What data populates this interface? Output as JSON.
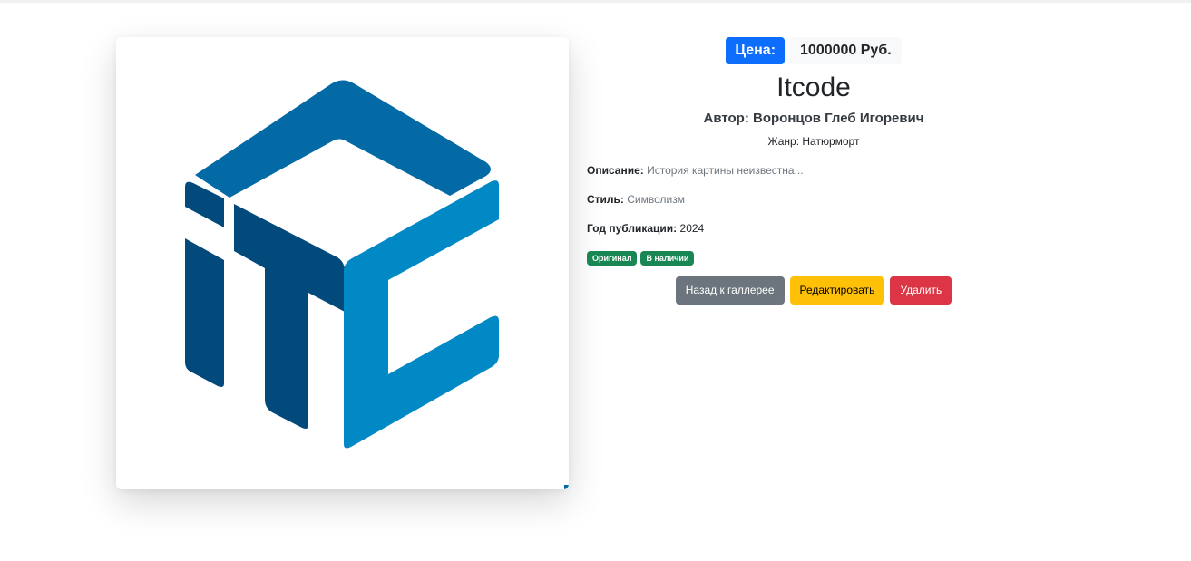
{
  "artwork": {
    "image_alt": "ITC logo",
    "logo_colors": {
      "dark_blue": "#02497c",
      "mid_blue": "#036aa5",
      "light_blue": "#0189c6"
    }
  },
  "price": {
    "label": "Цена:",
    "value": "1000000 Руб.",
    "label_color": "#0d6efd"
  },
  "title": "Itcode",
  "author": "Автор: Воронцов Глеб Игоревич",
  "genre": "Жанр: Натюрморт",
  "description": {
    "label": "Описание:",
    "value": "История картины неизвестна..."
  },
  "style": {
    "label": "Стиль:",
    "value": "Символизм"
  },
  "year": {
    "label": "Год публикации:",
    "value": "2024"
  },
  "badges": [
    "Оригинал",
    "В наличии"
  ],
  "badge_color": "#198754",
  "actions": {
    "back": "Назад к галлерее",
    "edit": "Редактировать",
    "delete": "Удалить"
  }
}
